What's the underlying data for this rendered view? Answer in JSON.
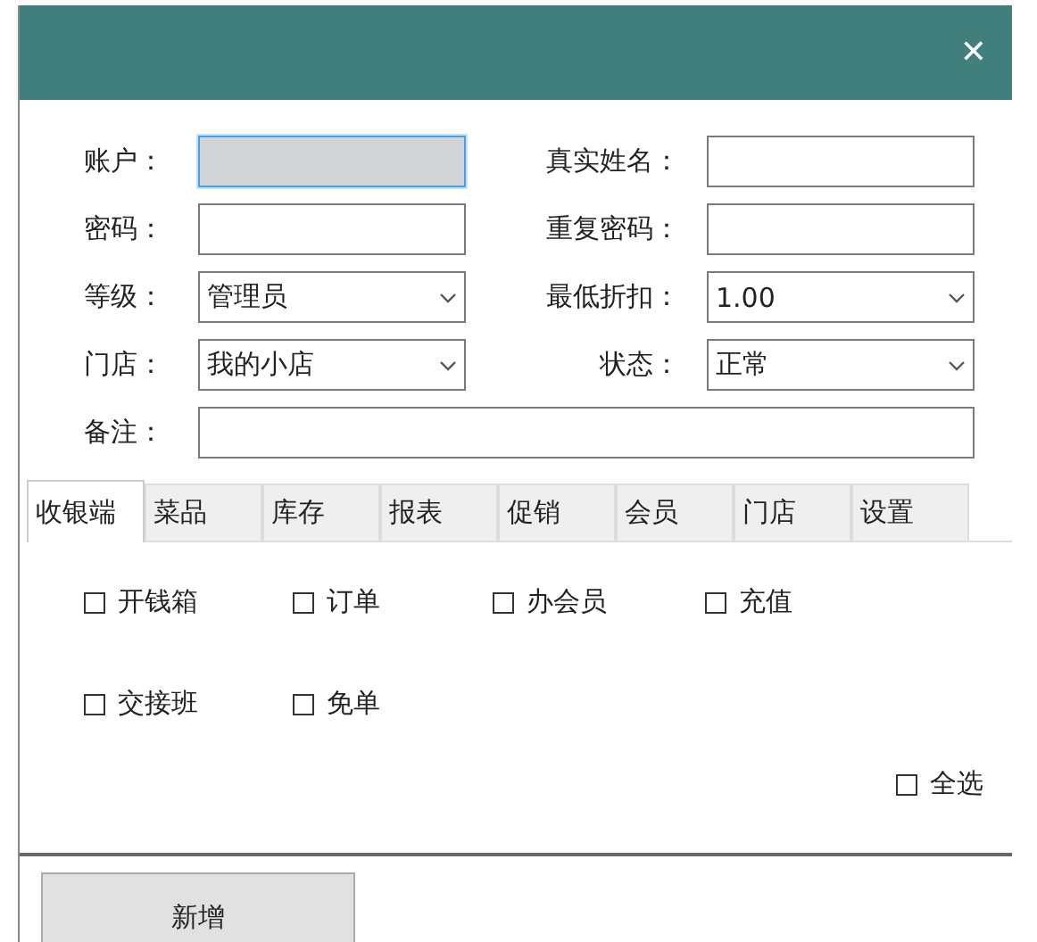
{
  "window": {
    "close_glyph": "✕"
  },
  "form": {
    "fields": [
      {
        "label": "账户：",
        "kind": "text",
        "disabled": true,
        "focused": true
      },
      {
        "label": "真实姓名：",
        "kind": "text",
        "disabled": false,
        "focused": false
      },
      {
        "label": "密码：",
        "kind": "text",
        "disabled": false,
        "focused": false
      },
      {
        "label": "重复密码：",
        "kind": "text",
        "disabled": false,
        "focused": false
      },
      {
        "label": "等级：",
        "kind": "select",
        "value": "管理员",
        "disabled": false,
        "focused": false
      },
      {
        "label": "最低折扣：",
        "kind": "select",
        "value": "1.00",
        "disabled": false,
        "focused": false
      },
      {
        "label": "门店：",
        "kind": "select",
        "value": "我的小店",
        "disabled": false,
        "focused": false
      },
      {
        "label": "状态：",
        "kind": "select",
        "value": "正常",
        "disabled": false,
        "focused": false
      }
    ],
    "note": {
      "label": "备注："
    }
  },
  "tabs": [
    {
      "label": "收银端",
      "selected": true
    },
    {
      "label": "菜品",
      "selected": false
    },
    {
      "label": "库存",
      "selected": false
    },
    {
      "label": "报表",
      "selected": false
    },
    {
      "label": "促销",
      "selected": false
    },
    {
      "label": "会员",
      "selected": false
    },
    {
      "label": "门店",
      "selected": false
    },
    {
      "label": "设置",
      "selected": false
    }
  ],
  "permissions": [
    {
      "label": "开钱箱",
      "checked": false
    },
    {
      "label": "订单",
      "checked": false
    },
    {
      "label": "办会员",
      "checked": false
    },
    {
      "label": "充值",
      "checked": false
    },
    {
      "label": "交接班",
      "checked": false
    },
    {
      "label": "免单",
      "checked": false
    }
  ],
  "select_all": {
    "label": "全选",
    "checked": false
  },
  "buttons": [
    "新增"
  ]
}
